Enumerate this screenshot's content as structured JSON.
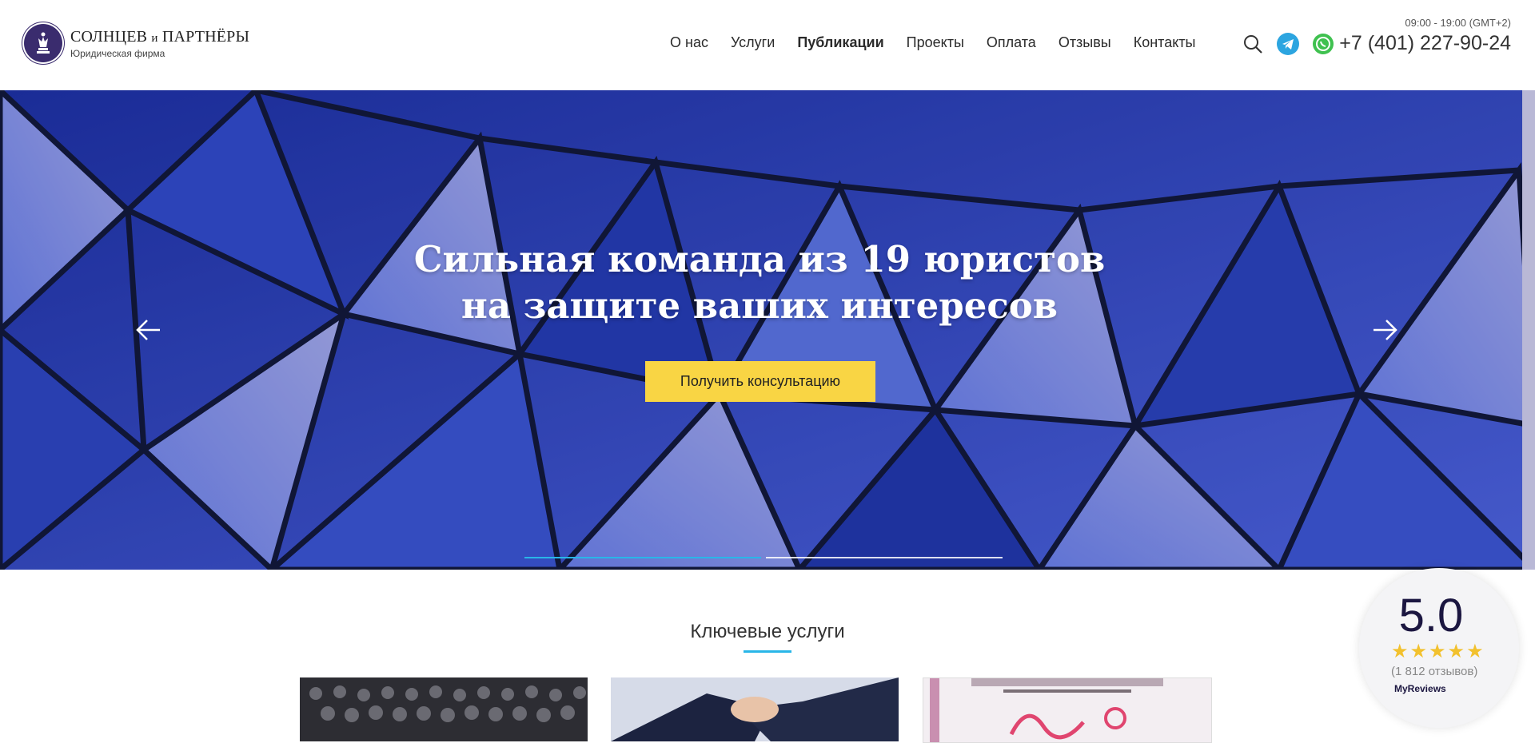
{
  "header": {
    "logo_title": "СОЛНЦЕВ",
    "logo_and": "и",
    "logo_title_2": "ПАРТНЁРЫ",
    "logo_subtitle": "Юридическая фирма",
    "nav": [
      {
        "label": "О нас"
      },
      {
        "label": "Услуги"
      },
      {
        "label": "Публикации"
      },
      {
        "label": "Проекты"
      },
      {
        "label": "Оплата"
      },
      {
        "label": "Отзывы"
      },
      {
        "label": "Контакты"
      }
    ],
    "hours": "09:00 - 19:00 (GMT+2)",
    "phone": "+7 (401) 227-90-24",
    "icons": [
      "search-icon",
      "telegram-icon",
      "whatsapp-icon"
    ]
  },
  "hero": {
    "title_line1": "Сильная команда из 19 юристов",
    "title_line2": "на защите ваших интересов",
    "cta_label": "Получить консультацию",
    "slides_count": 2,
    "active_slide": 1
  },
  "services": {
    "title": "Ключевые услуги"
  },
  "reviews": {
    "rating": "5.0",
    "stars": "★★★★★",
    "count": "(1 812 отзывов)",
    "brand": "MyReviews"
  },
  "colors": {
    "accent": "#29b6e8",
    "cta": "#f9d544",
    "logo": "#3a2c6e"
  }
}
